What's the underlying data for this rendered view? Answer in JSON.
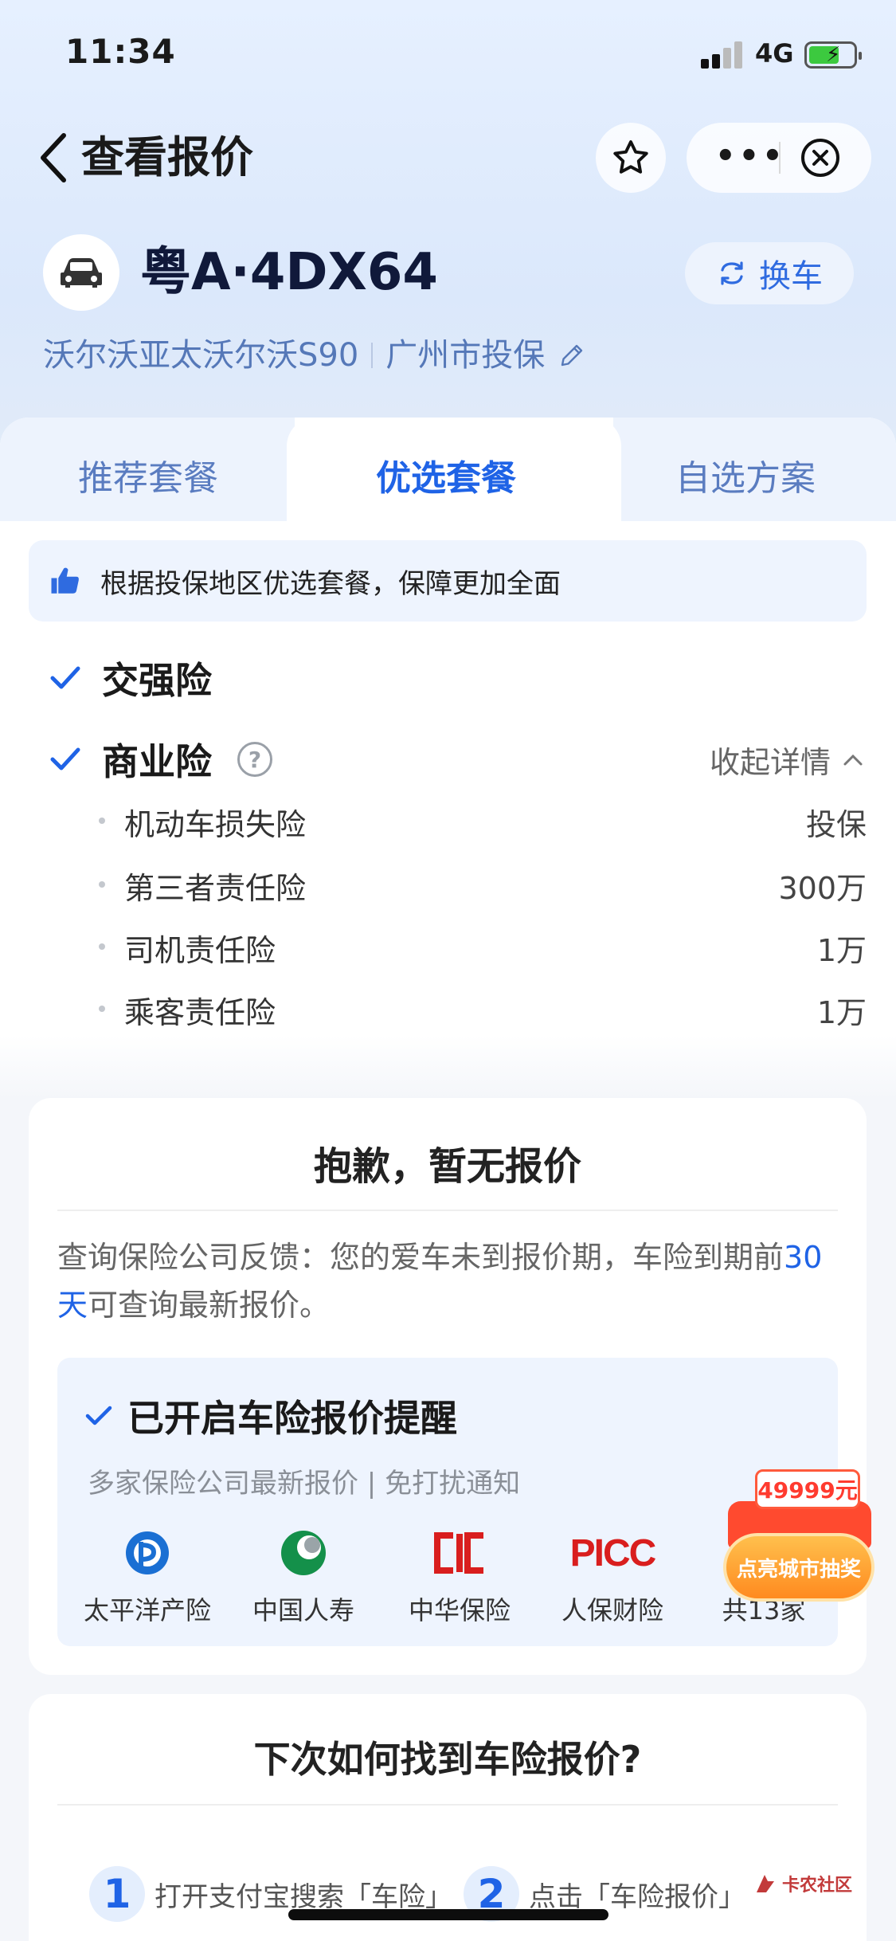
{
  "status_bar": {
    "time": "11:34",
    "network": "4G"
  },
  "nav": {
    "title": "查看报价"
  },
  "car": {
    "plate": "粤A·4DX64",
    "switch_label": "换车",
    "model": "沃尔沃亚太沃尔沃S90",
    "location": "广州市投保"
  },
  "tabs": [
    {
      "label": "推荐套餐"
    },
    {
      "label": "优选套餐",
      "active": true
    },
    {
      "label": "自选方案"
    }
  ],
  "tip": "根据投保地区优选套餐，保障更加全面",
  "coverage": {
    "compulsory": "交强险",
    "commercial": "商业险",
    "collapse_label": "收起详情",
    "items": [
      {
        "name": "机动车损失险",
        "value": "投保"
      },
      {
        "name": "第三者责任险",
        "value": "300万"
      },
      {
        "name": "司机责任险",
        "value": "1万"
      },
      {
        "name": "乘客责任险",
        "value": "1万"
      }
    ]
  },
  "no_quote": {
    "title": "抱歉，暂无报价",
    "desc_pre": "查询保险公司反馈：您的爱车未到报价期，车险到期前",
    "desc_highlight": "30天",
    "desc_post": "可查询最新报价。",
    "remind_title": "已开启车险报价提醒",
    "remind_sub": "多家保险公司最新报价 | 免打扰通知",
    "insurers": [
      {
        "name": "太平洋产险"
      },
      {
        "name": "中国人寿"
      },
      {
        "name": "中华保险"
      },
      {
        "name": "人保财险"
      },
      {
        "name": "共13家"
      }
    ],
    "picc_logo_text": "PICC"
  },
  "promo": {
    "amount": "49999元",
    "label": "点亮城市抽奖"
  },
  "howto": {
    "title": "下次如何找到车险报价?",
    "steps": [
      {
        "num": "1",
        "text": "打开支付宝搜索「车险」"
      },
      {
        "num": "2",
        "text": "点击「车险报价」"
      }
    ]
  },
  "watermark": "卡农社区",
  "colors": {
    "accent": "#1f63e6",
    "tip_bg": "#eef4fe",
    "promo_red": "#ff3b2f"
  }
}
